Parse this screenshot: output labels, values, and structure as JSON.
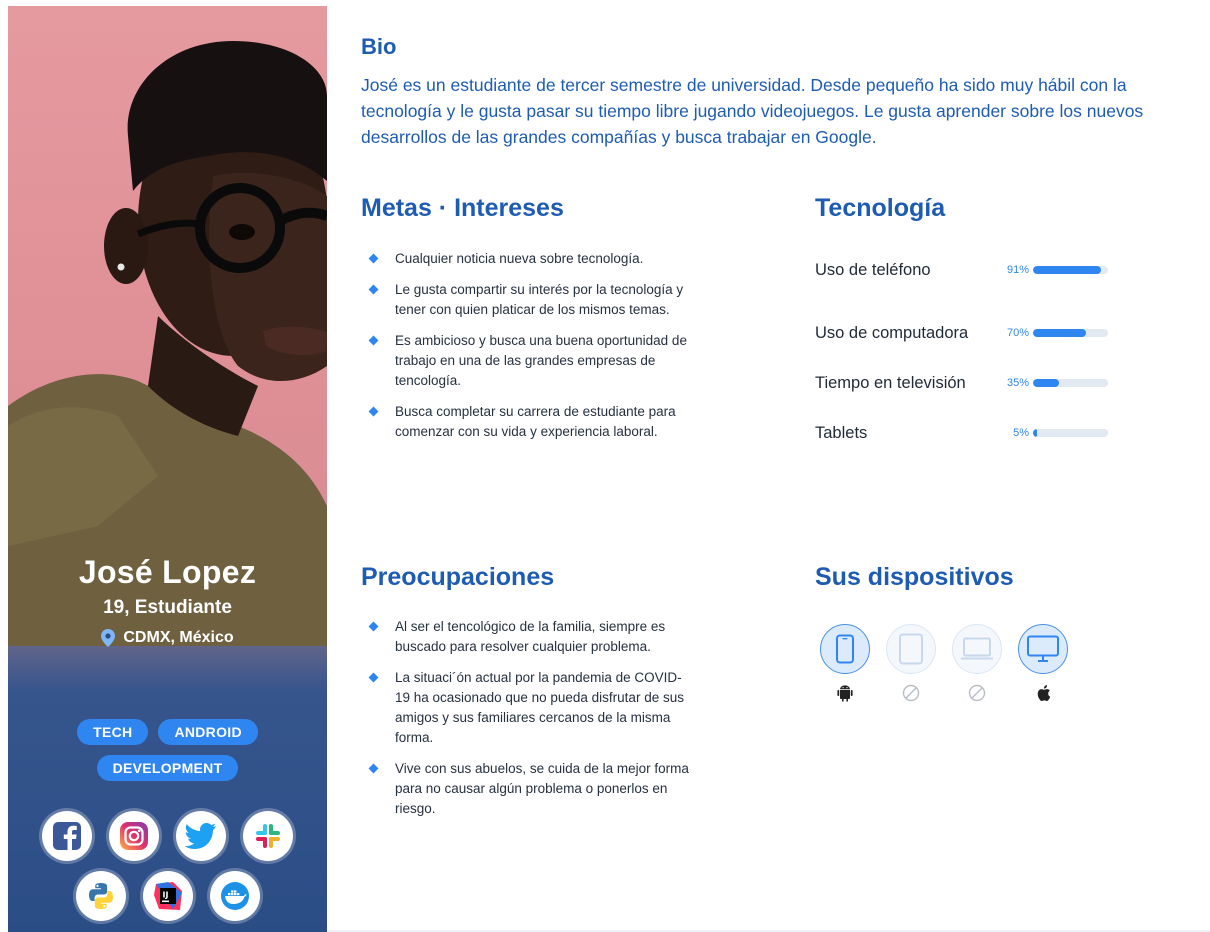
{
  "persona": {
    "name": "José Lopez",
    "age_role": "19, Estudiante",
    "location": "CDMX, México",
    "tags": [
      "TECH",
      "ANDROID",
      "DEVELOPMENT"
    ],
    "apps_row1": [
      "facebook-icon",
      "instagram-icon",
      "twitter-icon",
      "slack-icon"
    ],
    "apps_row2": [
      "python-icon",
      "intellij-icon",
      "docker-icon"
    ]
  },
  "bio": {
    "title": "Bio",
    "text": "José es un estudiante de tercer semestre de universidad. Desde pequeño ha sido muy hábil con la tecnología y le gusta pasar su tiempo libre jugando videojuegos. Le gusta aprender sobre los nuevos desarrollos de las grandes compañías y busca trabajar en Google."
  },
  "goals": {
    "title": "Metas · Intereses",
    "items": [
      "Cualquier noticia nueva sobre tecnología.",
      "Le gusta compartir su interés por la tecnología y tener con quien platicar de los mismos temas.",
      "Es ambicioso y busca una buena oportunidad de trabajo en una de las grandes empresas de tencología.",
      "Busca completar su carrera de estudiante para comenzar con su vida y experiencia laboral."
    ]
  },
  "technology": {
    "title": "Tecnología",
    "rows": [
      {
        "label": "Uso de teléfono",
        "pct_label": "91%",
        "value": 0.91
      },
      {
        "label": "Uso de computadora",
        "pct_label": "70%",
        "value": 0.7
      },
      {
        "label": "Tiempo en televisión",
        "pct_label": "35%",
        "value": 0.35
      },
      {
        "label": "Tablets",
        "pct_label": "5%",
        "value": 0.05
      }
    ]
  },
  "concerns": {
    "title": "Preocupaciones",
    "items": [
      "Al ser el tencológico de la familia, siempre es buscado para resolver cualquier problema.",
      "La situaci´ón actual por la pandemia de COVID-19 ha ocasionado que no pueda disfrutar de sus amigos y sus familiares cercanos de la misma forma.",
      "Vive con sus abuelos, se cuida de la mejor forma para no causar algún problema o ponerlos en riesgo."
    ]
  },
  "devices": {
    "title": "Sus dispositivos",
    "items": [
      {
        "icon": "phone-icon",
        "active": true,
        "os_icon": "android-icon"
      },
      {
        "icon": "tablet-icon",
        "active": false,
        "os_icon": "not-allowed-icon"
      },
      {
        "icon": "laptop-icon",
        "active": false,
        "os_icon": "not-allowed-icon"
      },
      {
        "icon": "monitor-icon",
        "active": true,
        "os_icon": "apple-icon"
      }
    ]
  },
  "colors": {
    "accent": "#2f86f0",
    "heading": "#1e5cb3",
    "panel_top": "#e59aa0",
    "panel_bottom": "#2b4d86"
  }
}
